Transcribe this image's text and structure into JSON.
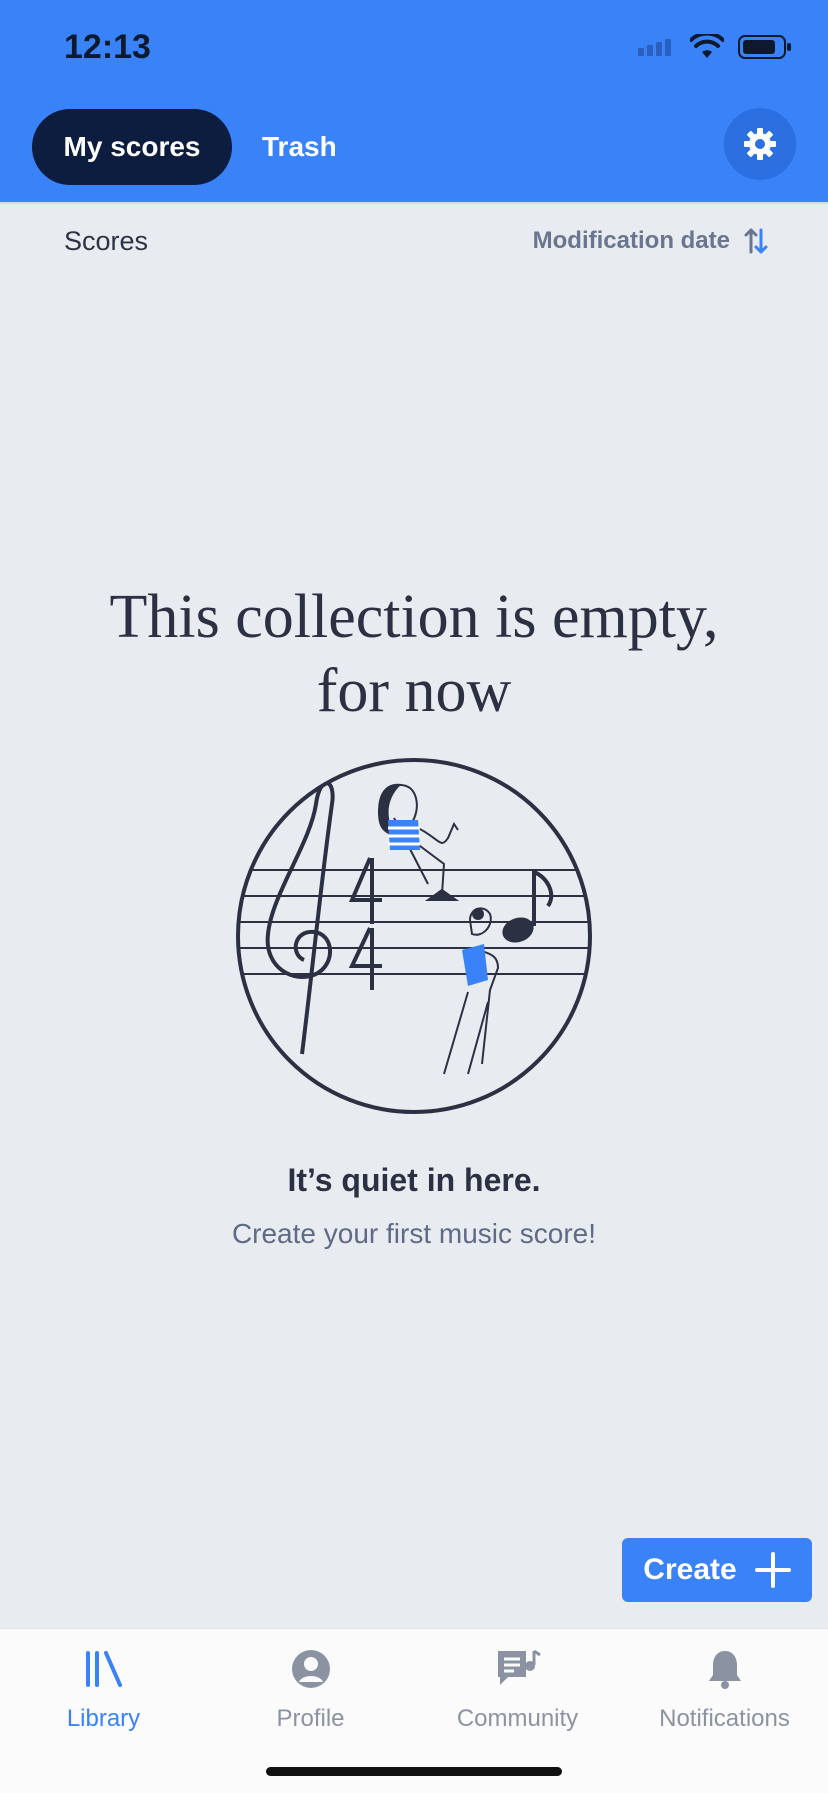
{
  "status_bar": {
    "time": "12:13"
  },
  "header": {
    "tabs": [
      {
        "label": "My scores"
      },
      {
        "label": "Trash"
      }
    ]
  },
  "list": {
    "section_label": "Scores",
    "sort_label": "Modification date"
  },
  "empty_state": {
    "title_line1": "This collection is empty,",
    "title_line2": "for now",
    "heading": "It’s quiet in here.",
    "subtitle": "Create your first music score!"
  },
  "create_button": {
    "label": "Create"
  },
  "bottom_nav": {
    "items": [
      {
        "label": "Library",
        "icon": "library-icon",
        "active": true
      },
      {
        "label": "Profile",
        "icon": "profile-icon"
      },
      {
        "label": "Community",
        "icon": "community-icon"
      },
      {
        "label": "Notifications",
        "icon": "bell-icon"
      }
    ]
  },
  "colors": {
    "accent": "#3a82f7",
    "dark_navy": "#0c1d3f",
    "background": "#e8ebef"
  }
}
